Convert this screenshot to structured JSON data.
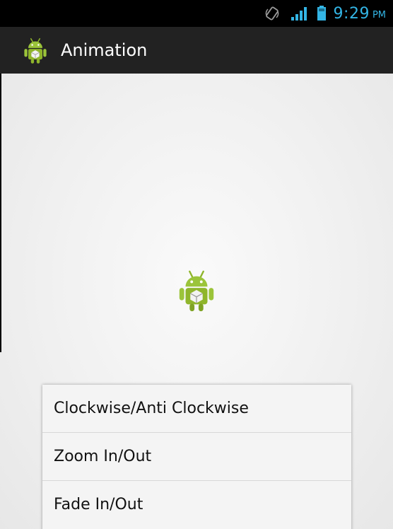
{
  "status_bar": {
    "time": "9:29",
    "ampm": "PM",
    "icons": [
      "rotation-lock-icon",
      "signal-icon",
      "battery-icon"
    ],
    "accent_color": "#33b5e5"
  },
  "action_bar": {
    "title": "Animation",
    "icon": "android-robot-icon"
  },
  "content": {
    "image": "android-robot-icon"
  },
  "menu": {
    "items": [
      {
        "label": "Clockwise/Anti Clockwise"
      },
      {
        "label": "Zoom In/Out"
      },
      {
        "label": "Fade In/Out"
      }
    ]
  }
}
